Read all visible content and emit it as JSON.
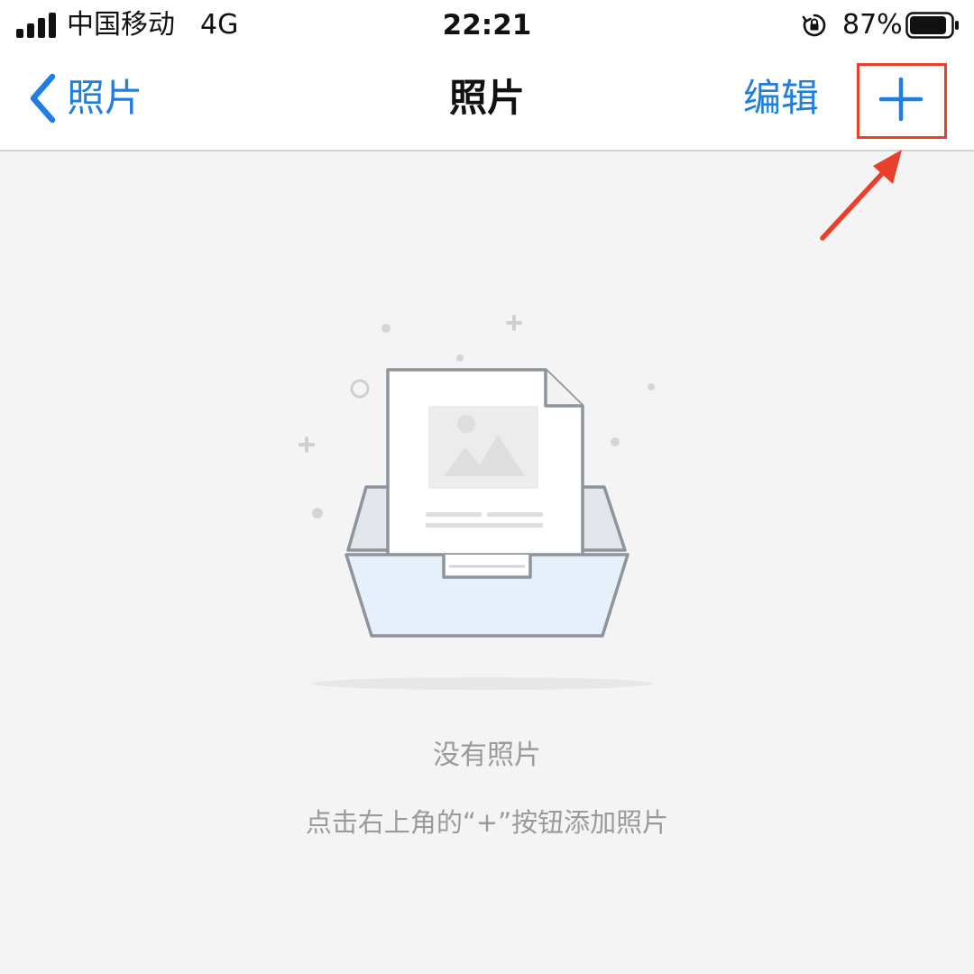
{
  "status_bar": {
    "carrier": "中国移动",
    "network": "4G",
    "time": "22:21",
    "battery_percent": "87%",
    "icons": [
      "signal-icon",
      "rotation-lock-icon",
      "battery-icon"
    ]
  },
  "nav": {
    "back_label": "照片",
    "title": "照片",
    "edit_label": "编辑",
    "add_icon": "plus-icon"
  },
  "annotation": {
    "highlight_color": "#e8402a",
    "target": "add-button"
  },
  "empty_state": {
    "illustration_icon": "empty-tray-image-icon",
    "title": "没有照片",
    "hint": "点击右上角的“+”按钮添加照片"
  },
  "colors": {
    "accent": "#1f7fe0",
    "background": "#f4f4f4",
    "muted_text": "#9a9a9a"
  }
}
